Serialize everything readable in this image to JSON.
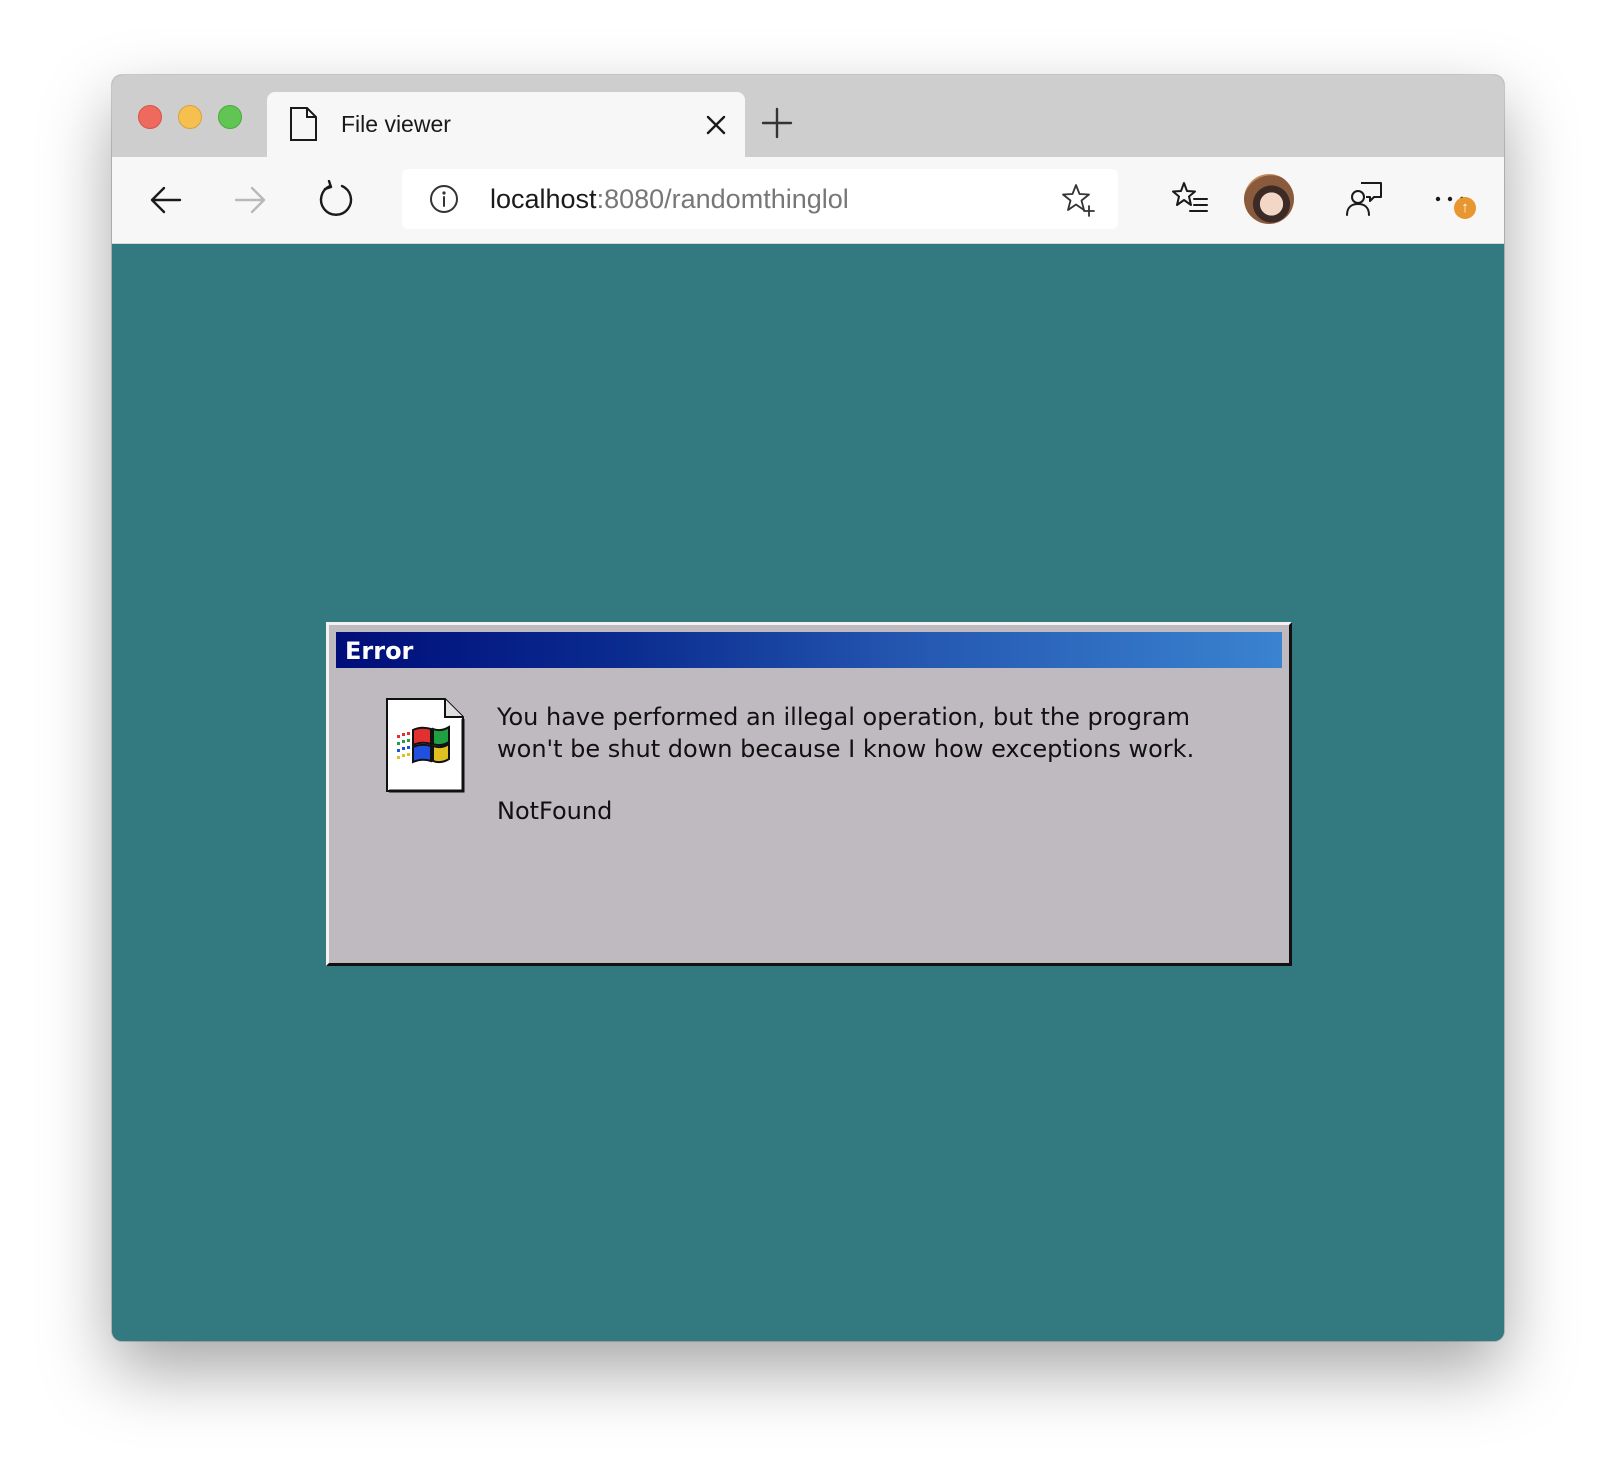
{
  "browser": {
    "tab": {
      "title": "File viewer",
      "icon": "document-icon"
    },
    "address": {
      "host": "localhost",
      "rest": ":8080/randomthinglol"
    },
    "update_badge": "↑"
  },
  "colors": {
    "page_background": "#337a80",
    "dialog_background": "#bfbabf",
    "titlebar_start": "#000e7a",
    "titlebar_end": "#3a83d0"
  },
  "dialog": {
    "title": "Error",
    "message": "You have performed an illegal operation, but the program won't be shut down because I know how exceptions work.",
    "error_code": "NotFound",
    "icon": "windows-file-icon"
  }
}
